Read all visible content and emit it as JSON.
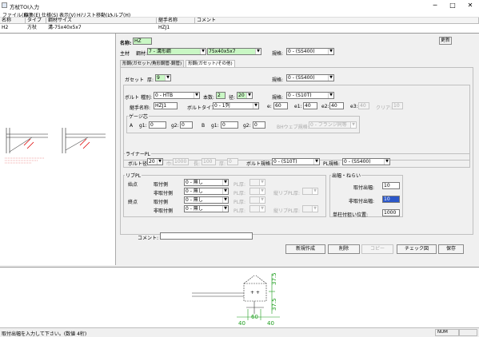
{
  "window": {
    "title": "方杖TOI入力",
    "minimize": "─",
    "maximize": "□",
    "close": "✕"
  },
  "menu": [
    "ファイル(F)",
    "編集(E)",
    "仕様(S)",
    "表示(V)",
    "Hiリスト移動(L)",
    "ヘルプ(H)"
  ],
  "grid": {
    "headers": [
      "名称",
      "タイプ",
      "鋼材サイズ",
      "継手名称",
      "コメント"
    ],
    "row": [
      "H2",
      "方杖",
      "溝-75x40x5x7",
      "HZJ1",
      ""
    ]
  },
  "form": {
    "name_label": "名称:",
    "name_value": "HZ",
    "update_button": "更新",
    "main_label": "主材",
    "steel_label": "鋼材:",
    "steel_type": "7 - 溝形鋼",
    "steel_size": "75x40x5x7",
    "spec_label": "規格:",
    "spec_value": "0 - (SS400)",
    "tabs": [
      "形鋼(ガセット/角形鋼管-鋼管)",
      "形鋼(ガセット/その他)"
    ],
    "gusset_label": "ガセット",
    "thick_label": "厚:",
    "thick_value": "9",
    "gusset_spec_label": "規格:",
    "gusset_spec_value": "0 - (SS400)",
    "bolt_label": "ボルト",
    "kind_label": "種別:",
    "kind_value": "0 - HTB",
    "count_label": "本数:",
    "count_value": "2",
    "dia_label": "径:",
    "dia_value": "20",
    "bolt_spec_label": "規格:",
    "bolt_spec_value": "0 - (S10T)",
    "joint_label": "継手名称:",
    "joint_value": "HZJ1",
    "btype_label": "ボルトタイプ:",
    "btype_value": "0 - 1列",
    "e_label": "e:",
    "e_value": "60",
    "e1_label": "e1:",
    "e1_value": "40",
    "e2_label": "e2:",
    "e2_value": "40",
    "e3_label": "e3:",
    "e3_value": "40",
    "clear_label": "クリア:",
    "clear_value": "10",
    "gauge_label": "ゲージ芯",
    "a_label": "A",
    "b_label": "B",
    "g1_label": "g1:",
    "g2_label": "g2:",
    "ga1": "0",
    "ga2": "0",
    "gb1": "0",
    "gb2": "0",
    "bh_label": "BHウェブ規格:",
    "bh_value": "0 - フランジ同等",
    "liner_title": "ライナーPL",
    "liner_dia_label": "ボルト径:",
    "liner_dia_value": "20",
    "liner_w_label": "巾:",
    "liner_w_value": "1000",
    "liner_len_label": "長:",
    "liner_len_value": "100",
    "liner_thick_label": "厚:",
    "liner_thick_value": "0",
    "liner_bspec_label": "ボルト規格:",
    "liner_bspec_value": "0 - (S10T)",
    "liner_plspec_label": "PL規格:",
    "liner_plspec_value": "0 - (SS400)",
    "rib_title": "リブPL",
    "start_label": "始点",
    "end_label": "終点",
    "attach_label": "取付側",
    "nonattach_label": "非取付側",
    "rib_value": "0 - 無し",
    "plthick_label": "PL厚:",
    "vrib_label": "縦リブPL厚:",
    "out_title": "出幅・ねらい",
    "out1_label": "取付出幅:",
    "out1_value": "10",
    "out2_label": "非取付出幅:",
    "out2_value": "10",
    "pos_label": "単柱付狙い位置:",
    "pos_value": "1000",
    "comment_label": "コメント:",
    "comment_value": ""
  },
  "buttons": {
    "new": "新規作成",
    "delete": "削除",
    "copy": "コピー",
    "check": "チェック図",
    "save": "保存"
  },
  "drawing": {
    "dim_top": "37.5",
    "dim_bottom": "37.5",
    "dim_a": "40",
    "dim_b": "60",
    "dim_c": "40"
  },
  "status": {
    "message": "取付出幅を入力して下さい。(数値 4桁)",
    "num": "NUM"
  }
}
